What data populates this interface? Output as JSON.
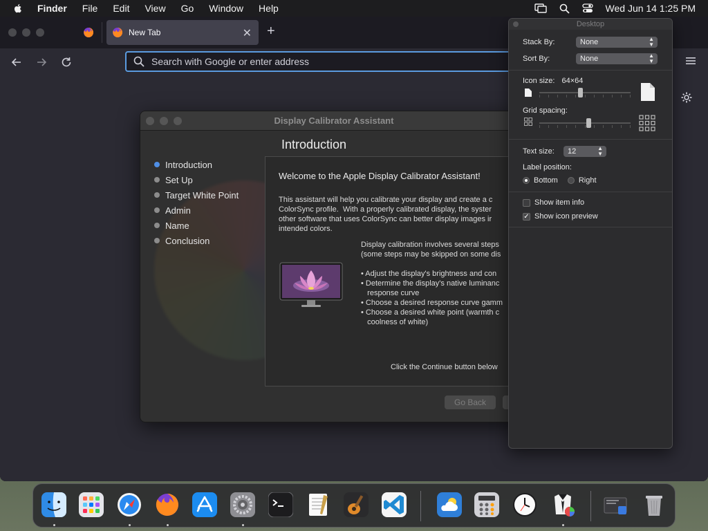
{
  "menubar": {
    "app": "Finder",
    "items": [
      "File",
      "Edit",
      "View",
      "Go",
      "Window",
      "Help"
    ],
    "clock": "Wed Jun 14  1:25 PM"
  },
  "browser": {
    "tab_label": "New Tab",
    "url_placeholder": "Search with Google or enter address"
  },
  "calibrator": {
    "title": "Display Calibrator Assistant",
    "heading": "Introduction",
    "steps": [
      {
        "label": "Introduction",
        "active": true
      },
      {
        "label": "Set Up",
        "active": false
      },
      {
        "label": "Target White Point",
        "active": false
      },
      {
        "label": "Admin",
        "active": false
      },
      {
        "label": "Name",
        "active": false
      },
      {
        "label": "Conclusion",
        "active": false
      }
    ],
    "welcome": "Welcome to the Apple Display Calibrator Assistant!",
    "paragraph": "This assistant will help you calibrate your display and create a c\nColorSync profile.  With a properly calibrated display, the syster\nother software that uses ColorSync can better display images ir\nintended colors.",
    "paragraph2": "Display calibration involves several steps\n(some steps may be skipped on some dis",
    "bullets": "• Adjust the display's brightness and con\n• Determine the display's native luminanc\n   response curve\n• Choose a desired response curve gamm\n• Choose a desired white point (warmth c\n   coolness of white)",
    "continue_text": "Click the Continue button below",
    "go_back": "Go Back"
  },
  "view_options": {
    "title": "Desktop",
    "stack_by_label": "Stack By:",
    "stack_by_value": "None",
    "sort_by_label": "Sort By:",
    "sort_by_value": "None",
    "icon_size_label": "Icon size:",
    "icon_size_value": "64×64",
    "icon_size_level": 0.45,
    "grid_spacing_label": "Grid spacing:",
    "grid_spacing_level": 0.54,
    "text_size_label": "Text size:",
    "text_size_value": "12",
    "label_position_label": "Label position:",
    "label_bottom": "Bottom",
    "label_right": "Right",
    "label_position_selected": "Bottom",
    "show_item_info": "Show item info",
    "show_item_info_checked": false,
    "show_icon_preview": "Show icon preview",
    "show_icon_preview_checked": true
  },
  "dock": {
    "apps": [
      {
        "name": "finder-icon",
        "color": "#3a8ee8",
        "running": true
      },
      {
        "name": "launchpad-icon",
        "color": "#c8c8cc",
        "running": false
      },
      {
        "name": "safari-icon",
        "color": "#2a7fe0",
        "running": true
      },
      {
        "name": "firefox-icon",
        "color": "#e8602c",
        "running": true
      },
      {
        "name": "app-store-icon",
        "color": "#1c8cf0",
        "running": false
      },
      {
        "name": "system-settings-icon",
        "color": "#8a8a8e",
        "running": true
      },
      {
        "name": "terminal-icon",
        "color": "#1a1a1a",
        "running": false
      },
      {
        "name": "textedit-icon",
        "color": "#f2f2f2",
        "running": false
      },
      {
        "name": "garageband-icon",
        "color": "#e88a2a",
        "running": false
      },
      {
        "name": "vscode-icon",
        "color": "#1f8ad2",
        "running": false
      },
      {
        "name": "weather-icon",
        "color": "#2f7fd8",
        "running": false
      },
      {
        "name": "calculator-icon",
        "color": "#d8d8d8",
        "running": false
      },
      {
        "name": "clock-icon",
        "color": "#f5f5f5",
        "running": false
      },
      {
        "name": "colorsync-icon",
        "color": "#e0e0e0",
        "running": true
      },
      {
        "name": "screenshot-stack-icon",
        "color": "#3a3a3e",
        "running": false
      },
      {
        "name": "trash-icon",
        "color": "#9a9aa0",
        "running": false
      }
    ]
  }
}
